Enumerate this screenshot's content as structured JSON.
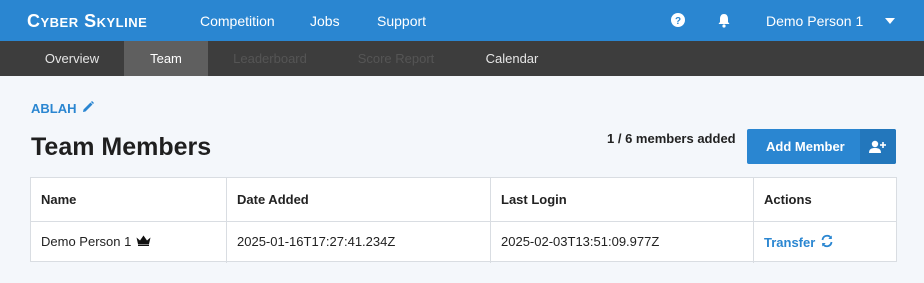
{
  "topbar": {
    "brand": "Cyber Skyline",
    "nav": [
      "Competition",
      "Jobs",
      "Support"
    ],
    "user_name": "Demo Person 1"
  },
  "subnav": {
    "tabs": [
      {
        "label": "Overview",
        "state": "normal"
      },
      {
        "label": "Team",
        "state": "active"
      },
      {
        "label": "Leaderboard",
        "state": "disabled"
      },
      {
        "label": "Score Report",
        "state": "disabled"
      },
      {
        "label": "Calendar",
        "state": "normal"
      }
    ]
  },
  "team": {
    "name": "ABLAH",
    "title": "Team Members",
    "member_count": "1 / 6 members added",
    "add_button": "Add Member"
  },
  "table": {
    "headers": [
      "Name",
      "Date Added",
      "Last Login",
      "Actions"
    ],
    "rows": [
      {
        "name": "Demo Person 1",
        "date_added": "2025-01-16T17:27:41.234Z",
        "last_login": "2025-02-03T13:51:09.977Z",
        "action": "Transfer"
      }
    ]
  },
  "colors": {
    "brand_blue": "#2a86d1",
    "subnav_bg": "#3d3d3d",
    "page_bg": "#f4f7fb"
  },
  "icons": [
    "help-circle-icon",
    "bell-icon",
    "chevron-down-icon",
    "pencil-icon",
    "add-user-icon",
    "crown-icon",
    "refresh-icon"
  ]
}
